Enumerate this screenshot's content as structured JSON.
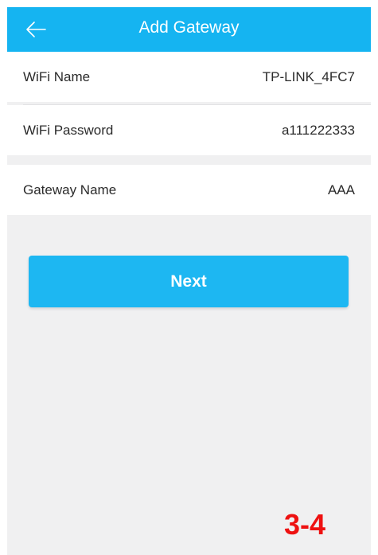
{
  "header": {
    "title": "Add Gateway",
    "back_icon": "arrow-left-icon"
  },
  "form": {
    "rows": [
      {
        "label": "WiFi Name",
        "value": "TP-LINK_4FC7"
      },
      {
        "label": "WiFi Password",
        "value": "a111222333"
      },
      {
        "label": "Gateway Name",
        "value": "AAA"
      }
    ]
  },
  "actions": {
    "next_label": "Next"
  },
  "annotation": {
    "step": "3-4"
  },
  "colors": {
    "header": "#15b4f1",
    "button": "#1db7f2",
    "background": "#f0f0f1",
    "annotation": "#ee1111"
  }
}
